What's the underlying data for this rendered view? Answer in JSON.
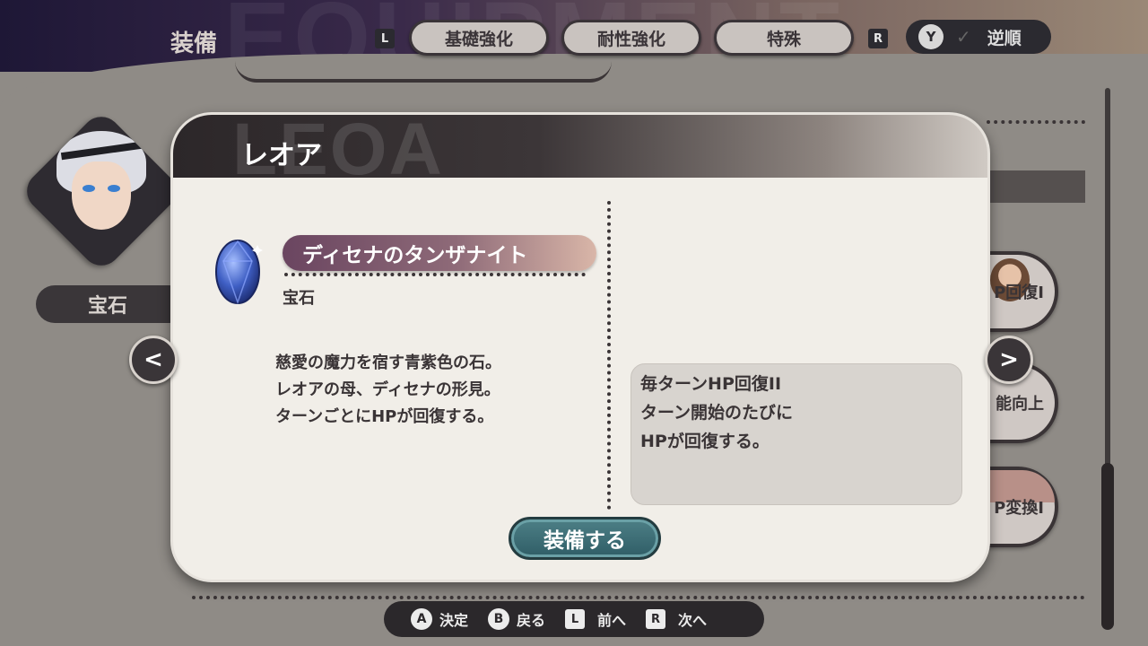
{
  "header": {
    "title": "装備",
    "watermark": "EQUIPMENT",
    "tab_prev_key": "L",
    "tab_next_key": "R",
    "tabs": [
      {
        "label": "基礎強化"
      },
      {
        "label": "耐性強化"
      },
      {
        "label": "特殊"
      }
    ],
    "reverse": {
      "button": "Y",
      "label": "逆順"
    }
  },
  "character": {
    "item_type_label": "宝石"
  },
  "background_chips": [
    {
      "label": "P回復I"
    },
    {
      "label": "能向上"
    },
    {
      "label": "P変換I"
    }
  ],
  "dialog": {
    "watermark": "LEOA",
    "character_name": "レオア",
    "item": {
      "name": "ディセナのタンザナイト",
      "category": "宝石",
      "gem_color": "#3f5fc4",
      "description": [
        "慈愛の魔力を宿す青紫色の石。",
        "レオアの母、ディセナの形見。",
        "ターンごとにHPが回復する。"
      ]
    },
    "effect": {
      "title": "毎ターンHP回復II",
      "lines": [
        "ターン開始のたびに",
        "HPが回復する。"
      ]
    },
    "equip_button": "装備する"
  },
  "footer": {
    "buttons": [
      {
        "key": "A",
        "label": "決定"
      },
      {
        "key": "B",
        "label": "戻る"
      },
      {
        "key": "L",
        "label": "前へ"
      },
      {
        "key": "R",
        "label": "次へ"
      }
    ]
  }
}
